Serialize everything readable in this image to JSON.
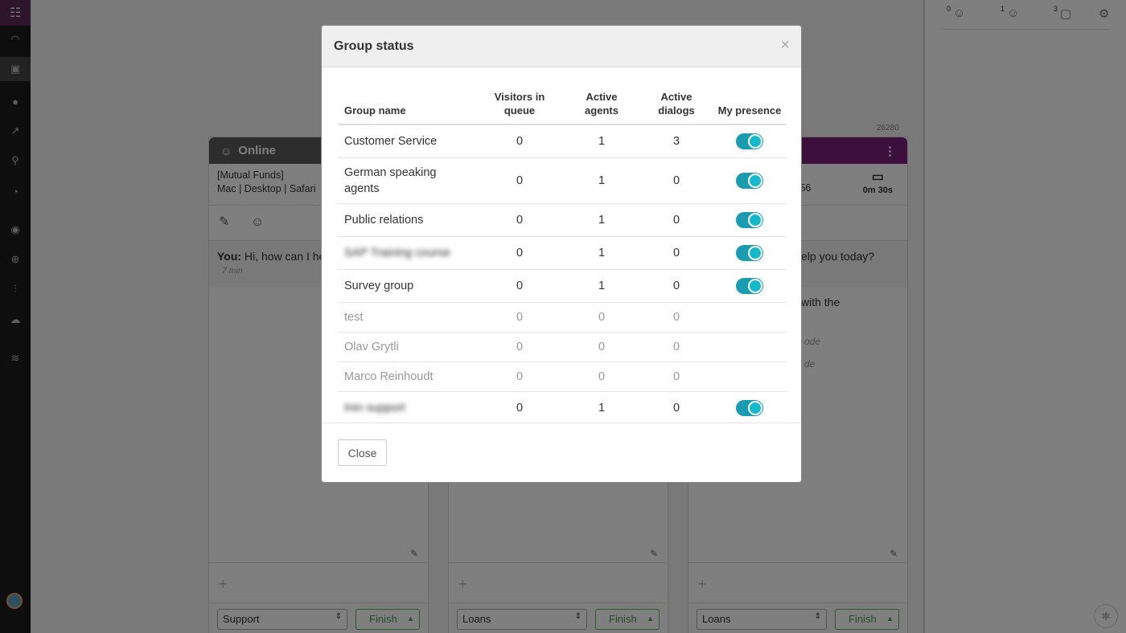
{
  "right_panel": {
    "counts": [
      "0",
      "1",
      "3"
    ],
    "icons": [
      "visitors-queue-icon",
      "agent-icon",
      "dialogs-icon",
      "gear-icon"
    ]
  },
  "ticket_id": "26280",
  "chats": [
    {
      "header": "Online",
      "info_line1": "[Mutual Funds]",
      "info_line2": "Mac | Desktop | Safari",
      "msg_you": "You:",
      "msg_text": "Hi, how can I he",
      "msg_time": "7 min",
      "group": "Support",
      "finish": "Finish"
    },
    {
      "group": "Loans",
      "finish": "Finish"
    },
    {
      "info_right": "e 56",
      "timer": "0m 30s",
      "msg_text": "elp you today?",
      "body_text": "with the",
      "hint1": "ode",
      "hint2": "de",
      "group": "Loans",
      "finish": "Finish"
    }
  ],
  "modal": {
    "title": "Group status",
    "close_x": "×",
    "columns": {
      "group_name": "Group name",
      "visitors_in_queue": "Visitors in queue",
      "active_agents": "Active agents",
      "active_dialogs": "Active dialogs",
      "my_presence": "My presence"
    },
    "rows": [
      {
        "name": "Customer Service",
        "queue": "0",
        "agents": "1",
        "dialogs": "3",
        "presence": true,
        "inactive": false,
        "blurred": false
      },
      {
        "name": "German speaking agents",
        "queue": "0",
        "agents": "1",
        "dialogs": "0",
        "presence": true,
        "inactive": false,
        "blurred": false
      },
      {
        "name": "Public relations",
        "queue": "0",
        "agents": "1",
        "dialogs": "0",
        "presence": true,
        "inactive": false,
        "blurred": false
      },
      {
        "name": "SAP Training course",
        "queue": "0",
        "agents": "1",
        "dialogs": "0",
        "presence": true,
        "inactive": false,
        "blurred": true
      },
      {
        "name": "Survey group",
        "queue": "0",
        "agents": "1",
        "dialogs": "0",
        "presence": true,
        "inactive": false,
        "blurred": false
      },
      {
        "name": "test",
        "queue": "0",
        "agents": "0",
        "dialogs": "0",
        "presence": false,
        "inactive": true,
        "blurred": false
      },
      {
        "name": "Olav Grytli",
        "queue": "0",
        "agents": "0",
        "dialogs": "0",
        "presence": false,
        "inactive": true,
        "blurred": false
      },
      {
        "name": "Marco Reinhoudt",
        "queue": "0",
        "agents": "0",
        "dialogs": "0",
        "presence": false,
        "inactive": true,
        "blurred": false
      },
      {
        "name": "Inin support",
        "queue": "0",
        "agents": "1",
        "dialogs": "0",
        "presence": true,
        "inactive": false,
        "blurred": true
      }
    ],
    "close_button": "Close"
  },
  "colors": {
    "toggle_on": "#16b8cc",
    "chat_header_purple": "#7b1f78",
    "finish_green": "#5cb85c"
  }
}
